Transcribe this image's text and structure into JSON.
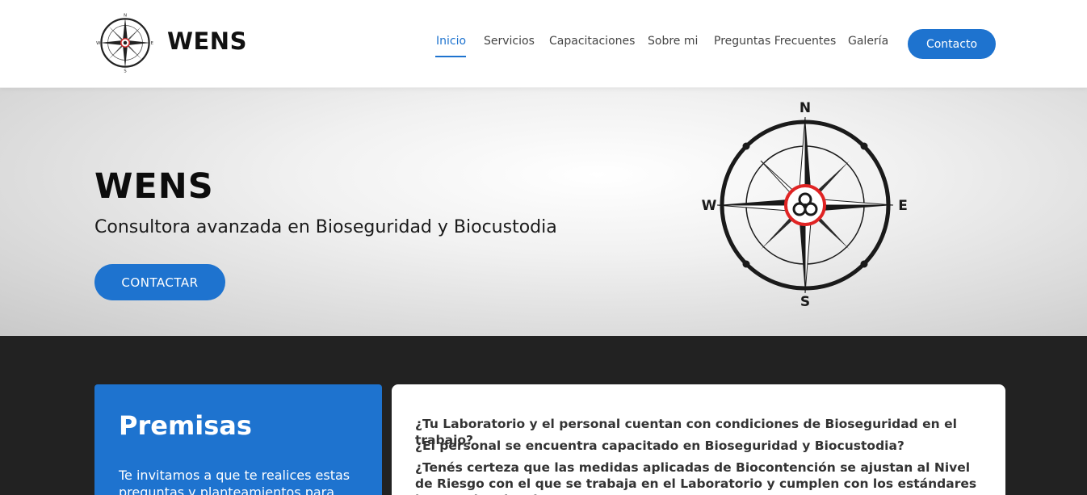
{
  "header": {
    "brand": "WENS",
    "logo_icon": "compass-biohazard-logo",
    "nav": [
      {
        "label": "Inicio",
        "active": true
      },
      {
        "label": "Servicios",
        "active": false
      },
      {
        "label": "Capacitaciones",
        "active": false
      },
      {
        "label": "Sobre mi",
        "active": false
      },
      {
        "label": "Preguntas Frecuentes",
        "active": false
      },
      {
        "label": "Galería",
        "active": false
      }
    ],
    "contact_label": "Contacto"
  },
  "hero": {
    "title": "WENS",
    "subtitle": "Consultora avanzada en Bioseguridad y Biocustodia",
    "cta_label": "CONTACTAR",
    "compass": {
      "n": "N",
      "s": "S",
      "e": "E",
      "w": "W"
    }
  },
  "premisas": {
    "title": "Premisas",
    "text": "Te invitamos a que te realices estas preguntas y planteamientos para saber"
  },
  "questions": [
    "¿Tu Laboratorio y el personal cuentan con condiciones de Bioseguridad en el trabajo?",
    "¿El personal se encuentra capacitado en Bioseguridad y Biocustodia?",
    "¿Tenés certeza que las medidas aplicadas de Biocontención se ajustan al Nivel de Riesgo con el que se trabaja en el Laboratorio y cumplen con los estándares internacionales de"
  ],
  "colors": {
    "accent": "#1e73cf",
    "dark_bg": "#222222",
    "biohazard_red": "#e02424"
  }
}
